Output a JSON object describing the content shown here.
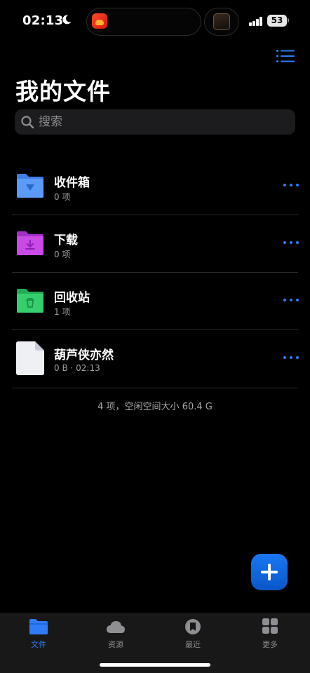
{
  "status_bar": {
    "time": "02:13",
    "battery": "53"
  },
  "header": {
    "title": "我的文件"
  },
  "search": {
    "placeholder": "搜索"
  },
  "files": [
    {
      "name": "收件箱",
      "subtitle": "0 项",
      "icon": "inbox-folder-icon",
      "color": "#4a8cf5"
    },
    {
      "name": "下载",
      "subtitle": "0 项",
      "icon": "download-folder-icon",
      "color": "#c03de0"
    },
    {
      "name": "回收站",
      "subtitle": "1 项",
      "icon": "trash-folder-icon",
      "color": "#2fc965"
    },
    {
      "name": "葫芦侠亦然",
      "subtitle": "0 B · 02:13",
      "icon": "document-icon",
      "color": "#eef0f3"
    }
  ],
  "summary": "4 项，空闲空间大小 60.4 G",
  "tabs": [
    {
      "label": "文件",
      "icon": "folder-icon",
      "active": true
    },
    {
      "label": "资源",
      "icon": "cloud-icon",
      "active": false
    },
    {
      "label": "最近",
      "icon": "recent-icon",
      "active": false
    },
    {
      "label": "更多",
      "icon": "grid-icon",
      "active": false
    }
  ],
  "colors": {
    "accent": "#2f7cf6",
    "background": "#000000",
    "tab_bar": "#181818"
  }
}
